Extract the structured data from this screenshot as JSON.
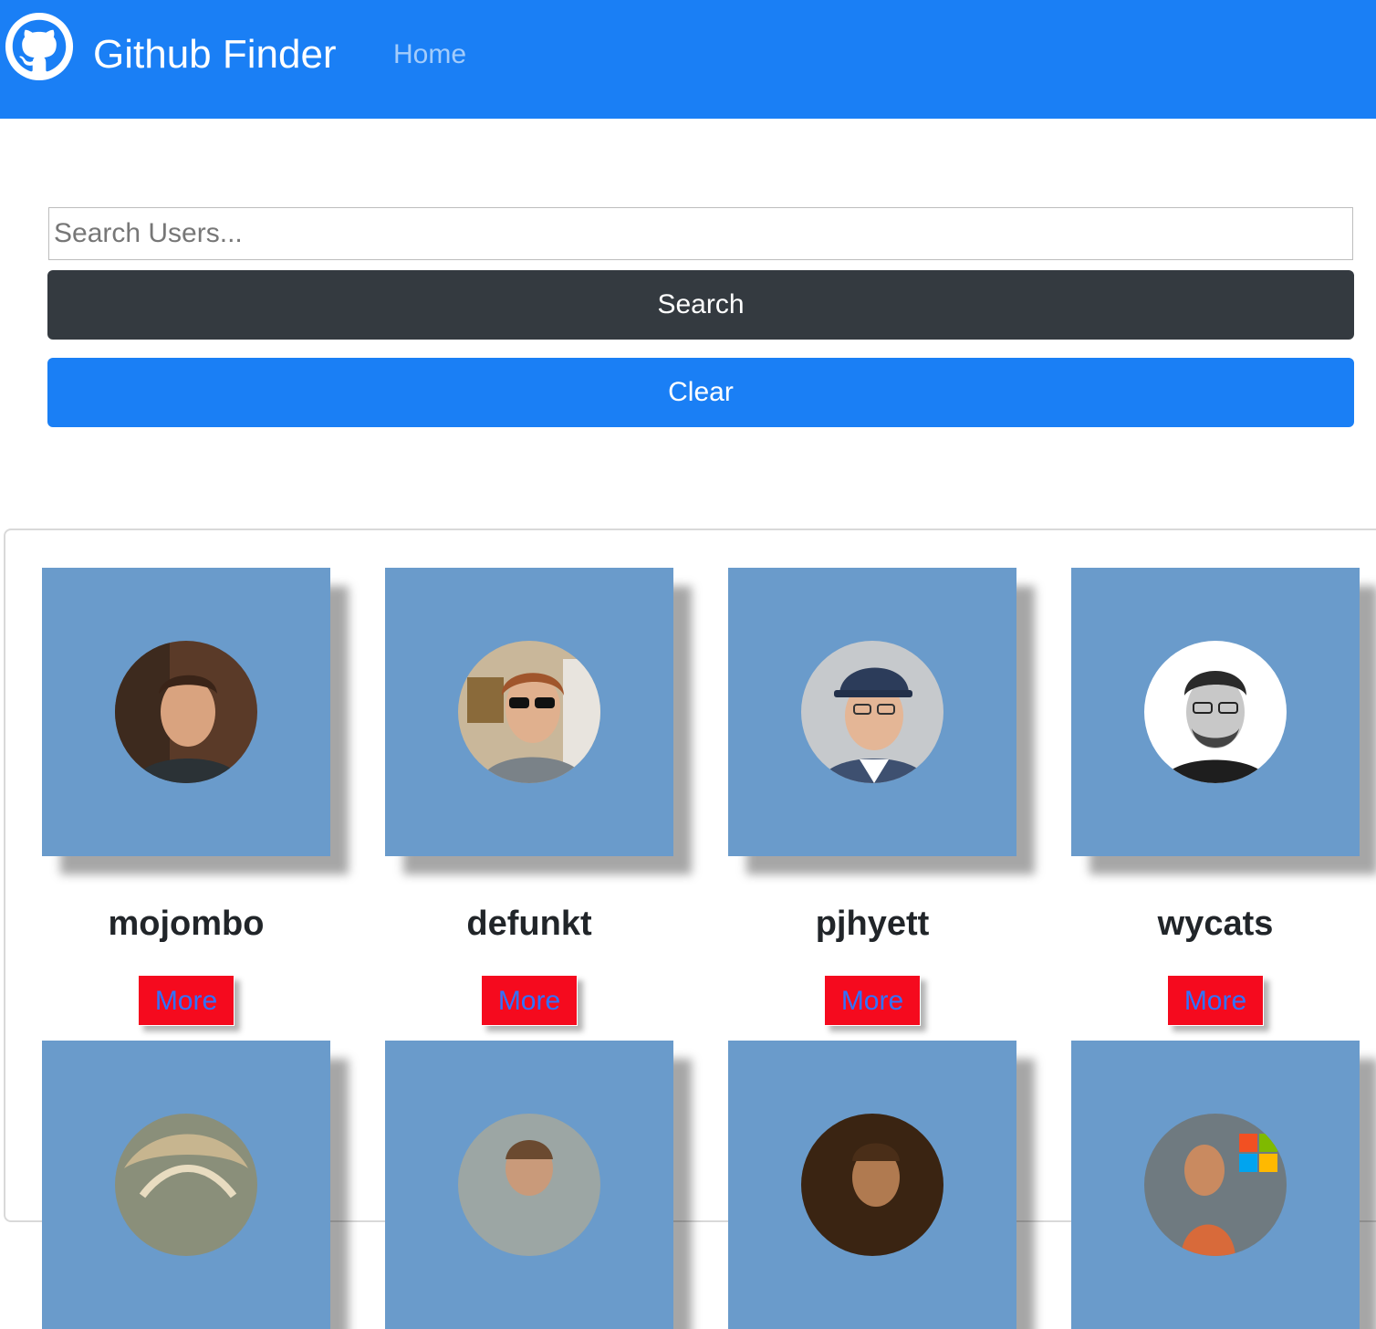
{
  "navbar": {
    "brand": "Github Finder",
    "home_link": "Home",
    "logo_icon": "github-icon"
  },
  "search": {
    "placeholder": "Search Users...",
    "value": "",
    "search_label": "Search",
    "clear_label": "Clear"
  },
  "users": [
    {
      "login": "mojombo",
      "more_label": "More"
    },
    {
      "login": "defunkt",
      "more_label": "More"
    },
    {
      "login": "pjhyett",
      "more_label": "More"
    },
    {
      "login": "wycats",
      "more_label": "More"
    },
    {
      "login": "",
      "more_label": ""
    },
    {
      "login": "",
      "more_label": ""
    },
    {
      "login": "",
      "more_label": ""
    },
    {
      "login": "",
      "more_label": ""
    }
  ],
  "colors": {
    "navbar": "#1a7ff5",
    "card": "#6a9bcb",
    "more_button": "#f50a1e",
    "search_button": "#343a40"
  }
}
